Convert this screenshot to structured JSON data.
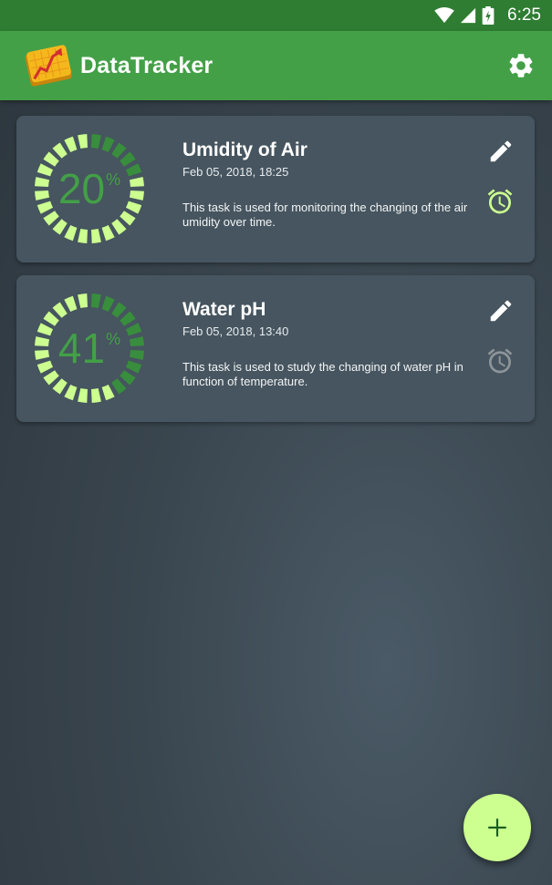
{
  "status_bar": {
    "time": "6:25"
  },
  "app_bar": {
    "title": "DataTracker"
  },
  "tasks": [
    {
      "title": "Umidity of Air",
      "date": "Feb 05, 2018, 18:25",
      "description": "This task is used for monitoring the changing of the air umidity over time.",
      "progress": 20,
      "progress_label": "20",
      "percent_sign": "%",
      "alarm_active": true
    },
    {
      "title": "Water pH",
      "date": "Feb 05, 2018, 13:40",
      "description": "This task is used to study the changing of water pH in function of temperature.",
      "progress": 41,
      "progress_label": "41",
      "percent_sign": "%",
      "alarm_active": false
    }
  ],
  "colors": {
    "status_bar": "#2e7d32",
    "app_bar": "#43a047",
    "gauge_filled": "#388e3c",
    "gauge_empty": "#ccff90",
    "alarm_active": "#ccff90",
    "alarm_inactive": "#8e959a",
    "fab": "#ccff90"
  },
  "icons": [
    "wifi-icon",
    "cell-signal-icon",
    "battery-icon",
    "app-logo-icon",
    "gear-icon",
    "pencil-icon",
    "alarm-clock-icon",
    "plus-icon"
  ]
}
